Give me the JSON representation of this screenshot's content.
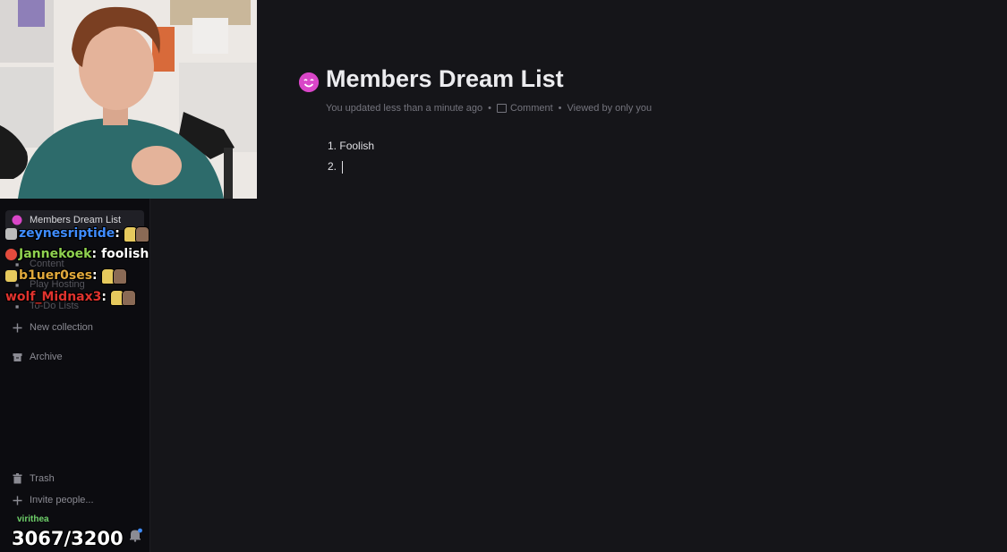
{
  "sidebar": {
    "items": {
      "active_doc": {
        "label": "Members Dream List"
      },
      "new_collection": {
        "label": "New collection"
      },
      "archive": {
        "label": "Archive"
      },
      "trash": {
        "label": "Trash"
      },
      "invite": {
        "label": "Invite people..."
      },
      "faded_content": {
        "label": "Content"
      },
      "faded_hosting": {
        "label": "Play Hosting"
      },
      "faded_todo": {
        "label": "To-Do Lists"
      }
    },
    "user": "virithea"
  },
  "document": {
    "title": "Members Dream List",
    "meta": {
      "updated": "You updated less than a minute ago",
      "comment": "Comment",
      "viewed": "Viewed by only you"
    },
    "list": [
      {
        "num": "1.",
        "text": "Foolish"
      },
      {
        "num": "2.",
        "text": ""
      }
    ]
  },
  "chat": [
    {
      "user": "zeynesriptide",
      "sep": ":",
      "message": "",
      "color": "#3f8cff"
    },
    {
      "user": "Jannekoek",
      "sep": ":",
      "message": "foolish",
      "color": "#8fd14f"
    },
    {
      "user": "b1uer0ses",
      "sep": ":",
      "message": "",
      "color": "#e2a93b"
    },
    {
      "user": "wolf_Midnax3",
      "sep": ":",
      "message": "",
      "color": "#e0332e"
    }
  ],
  "counter": "3067/3200",
  "colors": {
    "background": "#151519",
    "sidebar": "#0c0c10",
    "accent_emoji": "#d946c8"
  }
}
